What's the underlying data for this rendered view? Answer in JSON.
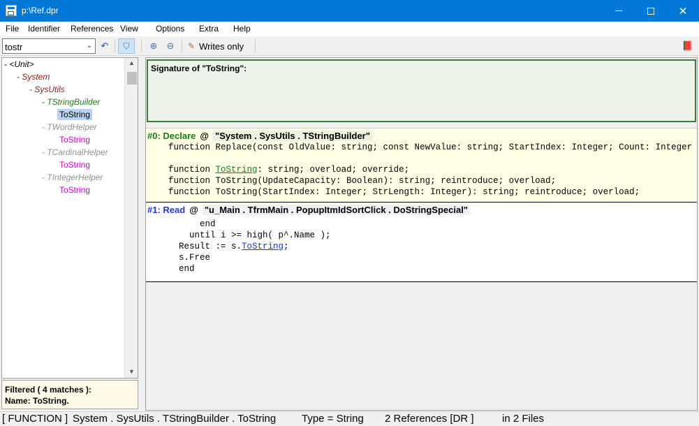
{
  "window": {
    "title": "p:\\Ref.dpr"
  },
  "menu": [
    "File",
    "Identifier",
    "References",
    "View",
    "Options",
    "Extra",
    "Help"
  ],
  "toolbar": {
    "search_value": "tostr",
    "writes_only_label": "Writes only"
  },
  "tree": {
    "unit": "- <Unit>",
    "system": "- System",
    "sysutils": "- SysUtils",
    "classes": [
      {
        "label": "- TStringBuilder",
        "member": "ToString",
        "active": true
      },
      {
        "label": "- TWordHelper",
        "member": "ToString",
        "active": false
      },
      {
        "label": "- TCardinalHelper",
        "member": "ToString",
        "active": false
      },
      {
        "label": "- TIntegerHelper",
        "member": "ToString",
        "active": false
      }
    ]
  },
  "filter": {
    "line1": "Filtered  ( 4 matches ):",
    "line2": "Name: ToString."
  },
  "signature": {
    "title": "Signature of \"ToString\":"
  },
  "refs": [
    {
      "kind": "#0: Declare",
      "at": "@",
      "path": "\"System . SysUtils . TStringBuilder\"",
      "lines": [
        "    function Replace(const OldValue: string; const NewValue: string; StartIndex: Integer; Count: Integer",
        "",
        "    function ",
        "    function ToString(UpdateCapacity: Boolean): string; reintroduce; overload;",
        "    function ToString(StartIndex: Integer; StrLength: Integer): string; reintroduce; overload;"
      ],
      "highlight_word": "ToString",
      "highlight_rest": ": string; overload; override;"
    },
    {
      "kind": "#1: Read",
      "at": "@",
      "path": "\"u_Main . TfrmMain . PopupItmIdSortClick . DoStringSpecial\"",
      "lines": [
        "          end",
        "        until i >= high( p^.Name );",
        "      Result := s.",
        "      s.Free",
        "      end"
      ],
      "highlight_word": "ToString",
      "highlight_rest": ";"
    }
  ],
  "status": {
    "kind": "[ FUNCTION ]",
    "path": "System . SysUtils . TStringBuilder . ToString",
    "type": "Type = String",
    "refs": "2 References [DR  ]",
    "files": "in 2 Files"
  }
}
